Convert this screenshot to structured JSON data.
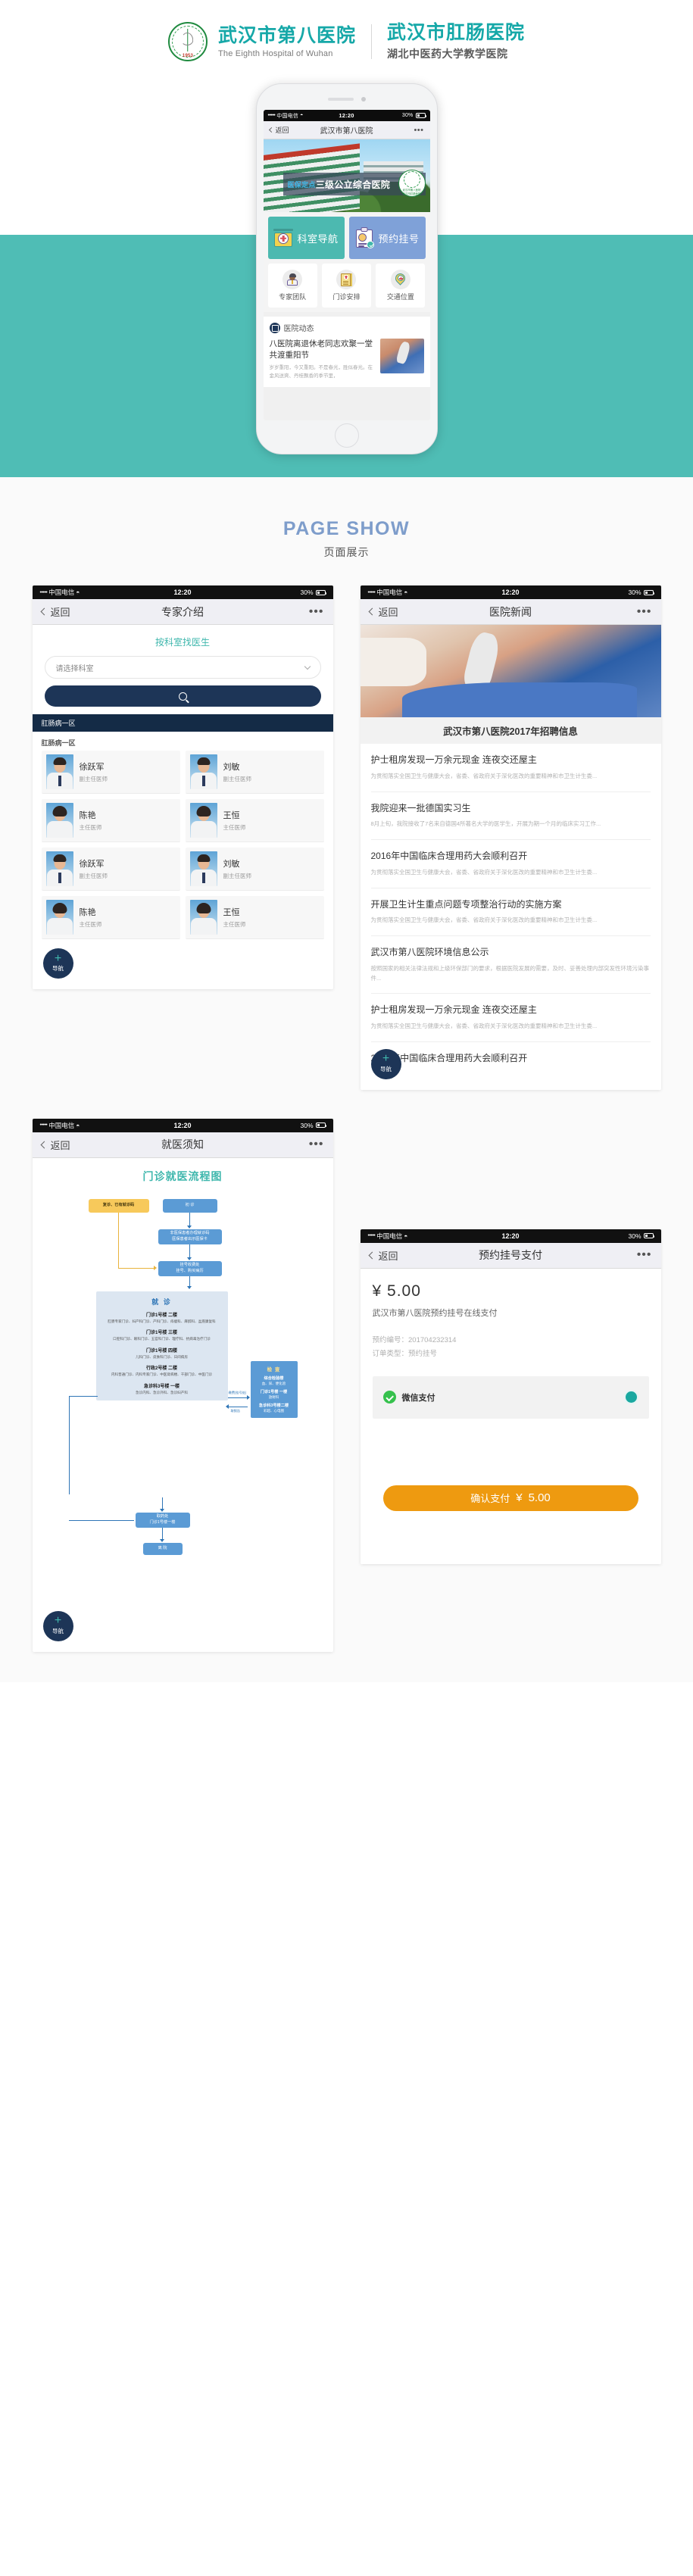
{
  "header": {
    "logo_year": "1953",
    "logo_arc_text": "The Eighth Hospital Of Wuhan",
    "name_cn": "武汉市第八医院",
    "name_en": "The Eighth Hospital of Wuhan",
    "name_cn2": "武汉市肛肠医院",
    "sub_cn2": "湖北中医药大学教学医院"
  },
  "phone": {
    "status": {
      "dots": "•••••",
      "carrier": "中国电信",
      "wifi": "wifi-icon",
      "time": "12:20",
      "battery": "30%"
    },
    "nav": {
      "back": "返回",
      "title": "武汉市第八医院",
      "more": "•••"
    },
    "banner": {
      "tag_small": "医保定点",
      "tag_big": "三级公立综合医院",
      "seal_line1": "武汉市第八医院",
      "seal_line2": "武汉市肛肠医院",
      "seal_year": "1953"
    },
    "tiles_big": [
      {
        "label": "科室导航",
        "icon": "hospital-sign-icon",
        "color": "#4cb9b0"
      },
      {
        "label": "预约挂号",
        "icon": "clipboard-check-icon",
        "color": "#7fa1d8"
      }
    ],
    "tiles_small": [
      {
        "label": "专家团队",
        "icon": "doctor-icon"
      },
      {
        "label": "门诊安排",
        "icon": "medical-book-icon"
      },
      {
        "label": "交通位置",
        "icon": "map-pin-icon"
      }
    ],
    "news": {
      "section_title": "医院动态",
      "section_icon": "news-book-icon",
      "title": "八医院离退休老同志欢聚一堂共渡重阳节",
      "summary": "岁岁重阳，今又重阳。不是春光，胜似春光。在金风送爽、丹桂飘香的季节里，"
    }
  },
  "showcase": {
    "title": "PAGE SHOW",
    "subtitle": "页面展示",
    "title_color": "#7e9dcb"
  },
  "panels": {
    "experts": {
      "status": {
        "dots": "•••••",
        "carrier": "中国电信",
        "time": "12:20",
        "battery": "30%"
      },
      "nav": {
        "back": "返回",
        "title": "专家介绍",
        "more": "•••"
      },
      "find_title": "按科室找医生",
      "select_placeholder": "请选择科室",
      "search_icon": "search-icon",
      "dept_bar": "肛肠病一区",
      "dept_label": "肛肠病一区",
      "doctors": [
        {
          "name": "徐跃军",
          "rank": "副主任医师",
          "gender": "male"
        },
        {
          "name": "刘敏",
          "rank": "副主任医师",
          "gender": "male"
        },
        {
          "name": "陈艳",
          "rank": "主任医师",
          "gender": "female"
        },
        {
          "name": "王恒",
          "rank": "主任医师",
          "gender": "female"
        },
        {
          "name": "徐跃军",
          "rank": "副主任医师",
          "gender": "male"
        },
        {
          "name": "刘敏",
          "rank": "副主任医师",
          "gender": "male"
        },
        {
          "name": "陈艳",
          "rank": "主任医师",
          "gender": "female"
        },
        {
          "name": "王恒",
          "rank": "主任医师",
          "gender": "female"
        }
      ],
      "fab": {
        "plus": "+",
        "label": "导航"
      }
    },
    "news": {
      "status": {
        "dots": "•••••",
        "carrier": "中国电信",
        "time": "12:20",
        "battery": "30%"
      },
      "nav": {
        "back": "返回",
        "title": "医院新闻",
        "more": "•••"
      },
      "hero_title": "武汉市第八医院2017年招聘信息",
      "items": [
        {
          "title": "护士租房发现一万余元现金 连夜交还屋主",
          "summary": "为贯彻落实全国卫生与健康大会，省委、省政府关于深化医改的重要精神和市卫生计生委..."
        },
        {
          "title": "我院迎来一批德国实习生",
          "summary": "8月上旬，我院接收了7名来自德国4所著名大学的医学生，开展为期一个月的临床实习工作..."
        },
        {
          "title": "2016年中国临床合理用药大会顺利召开",
          "summary": "为贯彻落实全国卫生与健康大会，省委、省政府关于深化医改的重要精神和市卫生计生委..."
        },
        {
          "title": "开展卫生计生重点问题专项整治行动的实施方案",
          "summary": "为贯彻落实全国卫生与健康大会，省委、省政府关于深化医改的重要精神和市卫生计生委..."
        },
        {
          "title": "武汉市第八医院环境信息公示",
          "summary": "按照国家的相关法律法规和上级环保部门的要求，根据医院发展的需要，及时、妥善处理内部突发性环境污染事件..."
        },
        {
          "title": "护士租房发现一万余元现金 连夜交还屋主",
          "summary": "为贯彻落实全国卫生与健康大会，省委、省政府关于深化医改的重要精神和市卫生计生委..."
        },
        {
          "title": "2016年中国临床合理用药大会顺利召开",
          "summary": ""
        }
      ],
      "fab": {
        "plus": "+",
        "label": "导航"
      }
    },
    "guide": {
      "status": {
        "dots": "•••••",
        "carrier": "中国电信",
        "time": "12:20",
        "battery": "30%"
      },
      "nav": {
        "back": "返回",
        "title": "就医须知",
        "more": "•••"
      },
      "flow_title": "门诊就医流程图",
      "nodes": {
        "revisit": "复诊、已有就诊码",
        "first": "初  诊",
        "card": "非医保患者办理就诊码\n医保患者出示医保卡",
        "register": "挂号收费处\n挂号、购买病历",
        "consult_title": "就  诊",
        "sections": [
          {
            "head": "门诊1号楼 二楼",
            "detail": "肛肠专家门诊、妇产科门诊、产科门诊、痔瘘科、麻醉科、盆底康复科"
          },
          {
            "head": "门诊1号楼 三楼",
            "detail": "口腔科门诊、眼科门诊、五官科门诊、理疗科、抗病毒治疗门诊"
          },
          {
            "head": "门诊1号楼 四楼",
            "detail": "儿科门诊、皮肤科门诊、日间病房"
          },
          {
            "head": "行政2号楼 二楼",
            "detail": "内科普通门诊、内科专家门诊、中医肾病楼、干部门诊、中医门诊"
          },
          {
            "head": "急诊科3号楼 一楼",
            "detail": "急诊内科、急诊外科、急诊妇产科"
          }
        ],
        "exam_title": "检  查",
        "exam_items": [
          {
            "head": "综合检验楼",
            "detail": "血、尿、便化验"
          },
          {
            "head": "门诊1号楼 一楼",
            "detail": "放射科"
          },
          {
            "head": "急诊科3号楼二楼",
            "detail": "彩超、心电图"
          }
        ],
        "label_pay": "缴费(挂号处)",
        "label_back": "取报告",
        "pharmacy": "取药处\n门诊1号楼一楼",
        "leave": "离  院"
      },
      "fab": {
        "plus": "+",
        "label": "导航"
      }
    },
    "payment": {
      "status": {
        "dots": "•••••",
        "carrier": "中国电信",
        "time": "12:20",
        "battery": "30%"
      },
      "nav": {
        "back": "返回",
        "title": "预约挂号支付",
        "more": "•••"
      },
      "currency": "¥",
      "amount": "5.00",
      "description": "武汉市第八医院预约挂号在线支付",
      "order_no_label": "预约编号：",
      "order_no": "201704232314",
      "order_type_label": "订单类型：",
      "order_type": "预约挂号",
      "method_icon": "wechat-pay-icon",
      "method_label": "微信支付",
      "method_selected": true,
      "confirm_label": "确认支付",
      "confirm_currency": "¥",
      "confirm_amount": "5.00",
      "confirm_color": "#ee9a10"
    }
  }
}
